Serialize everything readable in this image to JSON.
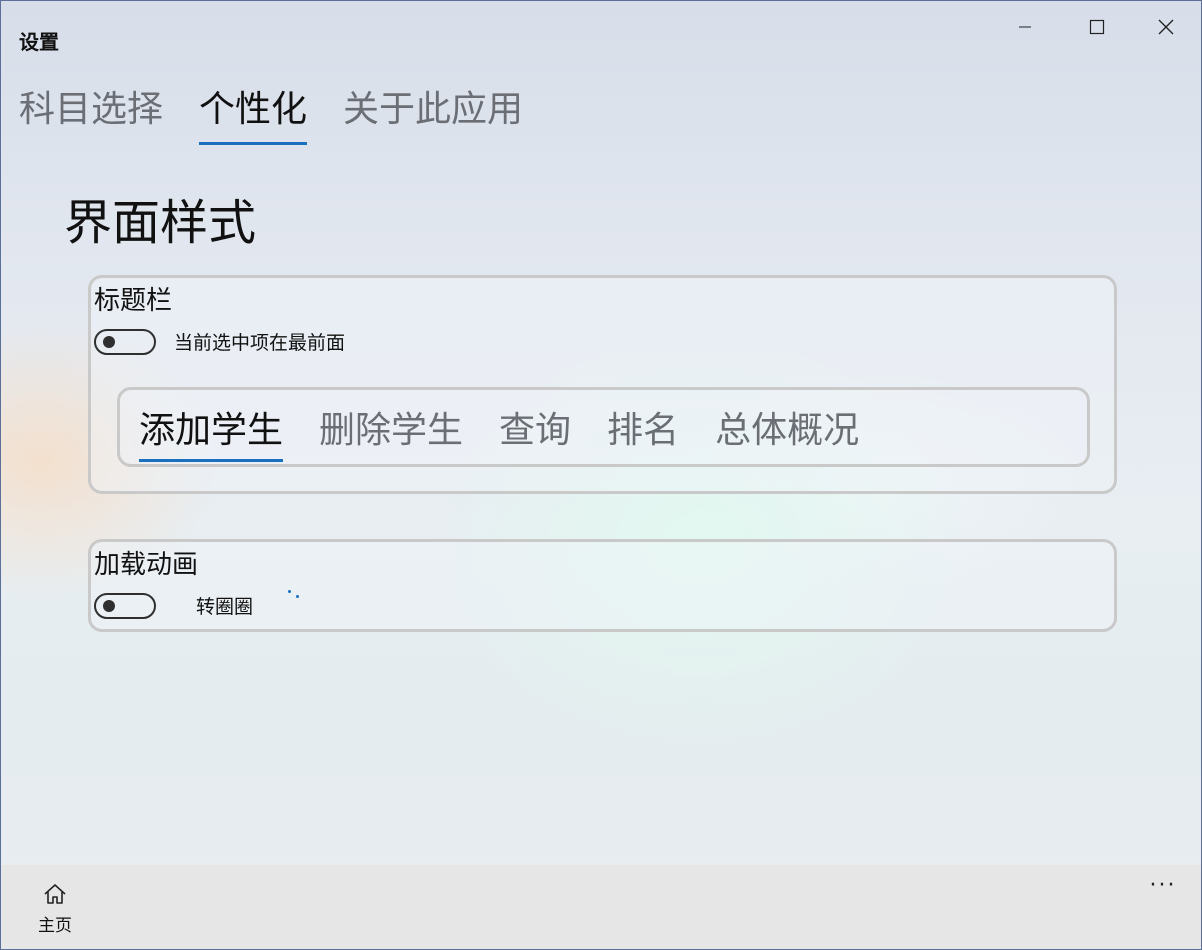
{
  "window": {
    "title": "设置"
  },
  "tabs": [
    {
      "label": "科目选择",
      "active": false
    },
    {
      "label": "个性化",
      "active": true
    },
    {
      "label": "关于此应用",
      "active": false
    }
  ],
  "section": {
    "title": "界面样式"
  },
  "titlebar_group": {
    "title": "标题栏",
    "toggle_label": "当前选中项在最前面",
    "toggle_on": false,
    "preview_tabs": [
      {
        "label": "添加学生",
        "active": true
      },
      {
        "label": "删除学生",
        "active": false
      },
      {
        "label": "查询",
        "active": false
      },
      {
        "label": "排名",
        "active": false
      },
      {
        "label": "总体概况",
        "active": false
      }
    ]
  },
  "loading_group": {
    "title": "加载动画",
    "toggle_label": "转圈圈",
    "toggle_on": false
  },
  "bottombar": {
    "home_label": "主页",
    "more_label": "···"
  },
  "colors": {
    "accent": "#1a6fbf",
    "card_border": "#c9c9c9",
    "bottombar": "#e6e6e6"
  },
  "icons": {
    "home": "home-icon",
    "minimize": "minimize-icon",
    "maximize": "maximize-icon",
    "close": "close-icon",
    "more": "more-icon"
  }
}
